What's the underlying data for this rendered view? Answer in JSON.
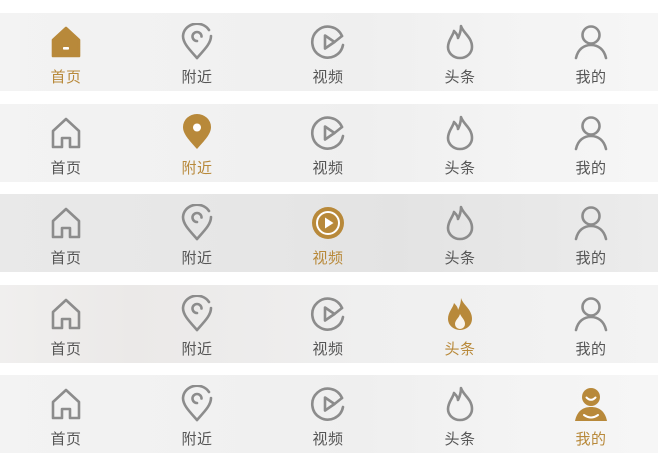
{
  "colors": {
    "active": "#b8893a",
    "inactive": "#8c8c8c",
    "inactive_text": "#555555"
  },
  "tab_labels": [
    "首页",
    "附近",
    "视频",
    "头条",
    "我的"
  ],
  "tab_icons": [
    "home-icon",
    "location-pin-icon",
    "video-play-icon",
    "flame-icon",
    "user-icon"
  ],
  "tabbars": [
    {
      "active_tab": "首页",
      "tabs": [
        {
          "label": "首页"
        },
        {
          "label": "附近"
        },
        {
          "label": "视频"
        },
        {
          "label": "头条"
        },
        {
          "label": "我的"
        }
      ]
    },
    {
      "active_tab": "附近",
      "tabs": [
        {
          "label": "首页"
        },
        {
          "label": "附近"
        },
        {
          "label": "视频"
        },
        {
          "label": "头条"
        },
        {
          "label": "我的"
        }
      ]
    },
    {
      "active_tab": "视频",
      "tabs": [
        {
          "label": "首页"
        },
        {
          "label": "附近"
        },
        {
          "label": "视频"
        },
        {
          "label": "头条"
        },
        {
          "label": "我的"
        }
      ]
    },
    {
      "active_tab": "头条",
      "tabs": [
        {
          "label": "首页"
        },
        {
          "label": "附近"
        },
        {
          "label": "视频"
        },
        {
          "label": "头条"
        },
        {
          "label": "我的"
        }
      ]
    },
    {
      "active_tab": "我的",
      "tabs": [
        {
          "label": "首页"
        },
        {
          "label": "附近"
        },
        {
          "label": "视频"
        },
        {
          "label": "头条"
        },
        {
          "label": "我的"
        }
      ]
    }
  ]
}
